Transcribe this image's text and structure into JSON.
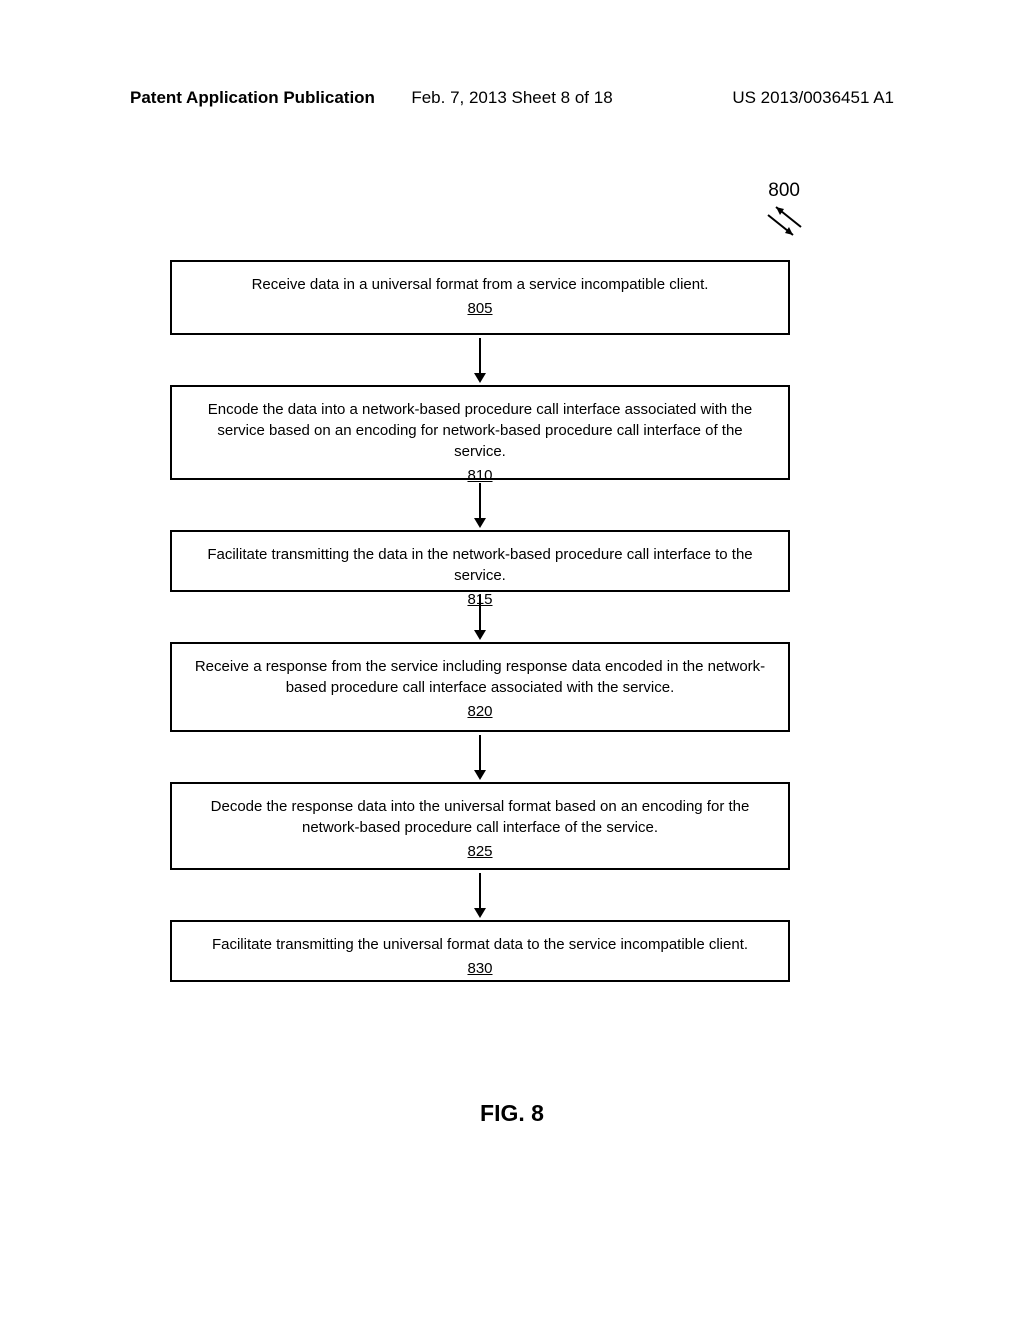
{
  "header": {
    "left": "Patent Application Publication",
    "center": "Feb. 7, 2013   Sheet 8 of 18",
    "right": "US 2013/0036451 A1"
  },
  "chart_data": {
    "type": "flowchart",
    "reference_number": "800",
    "figure_label": "FIG. 8",
    "steps": [
      {
        "number": "805",
        "text": "Receive data in a universal format from a service incompatible client."
      },
      {
        "number": "810",
        "text": "Encode the data into a network-based procedure call interface associated with the service based on an encoding for network-based procedure call interface of the service."
      },
      {
        "number": "815",
        "text": "Facilitate transmitting the data in the network-based procedure call interface to the service."
      },
      {
        "number": "820",
        "text": "Receive a response from the service including response data encoded in the network-based procedure call interface associated with the service."
      },
      {
        "number": "825",
        "text": "Decode the response data into the universal format based on an encoding for the network-based procedure call interface of the service."
      },
      {
        "number": "830",
        "text": "Facilitate transmitting the universal format data to the service incompatible client."
      }
    ]
  }
}
